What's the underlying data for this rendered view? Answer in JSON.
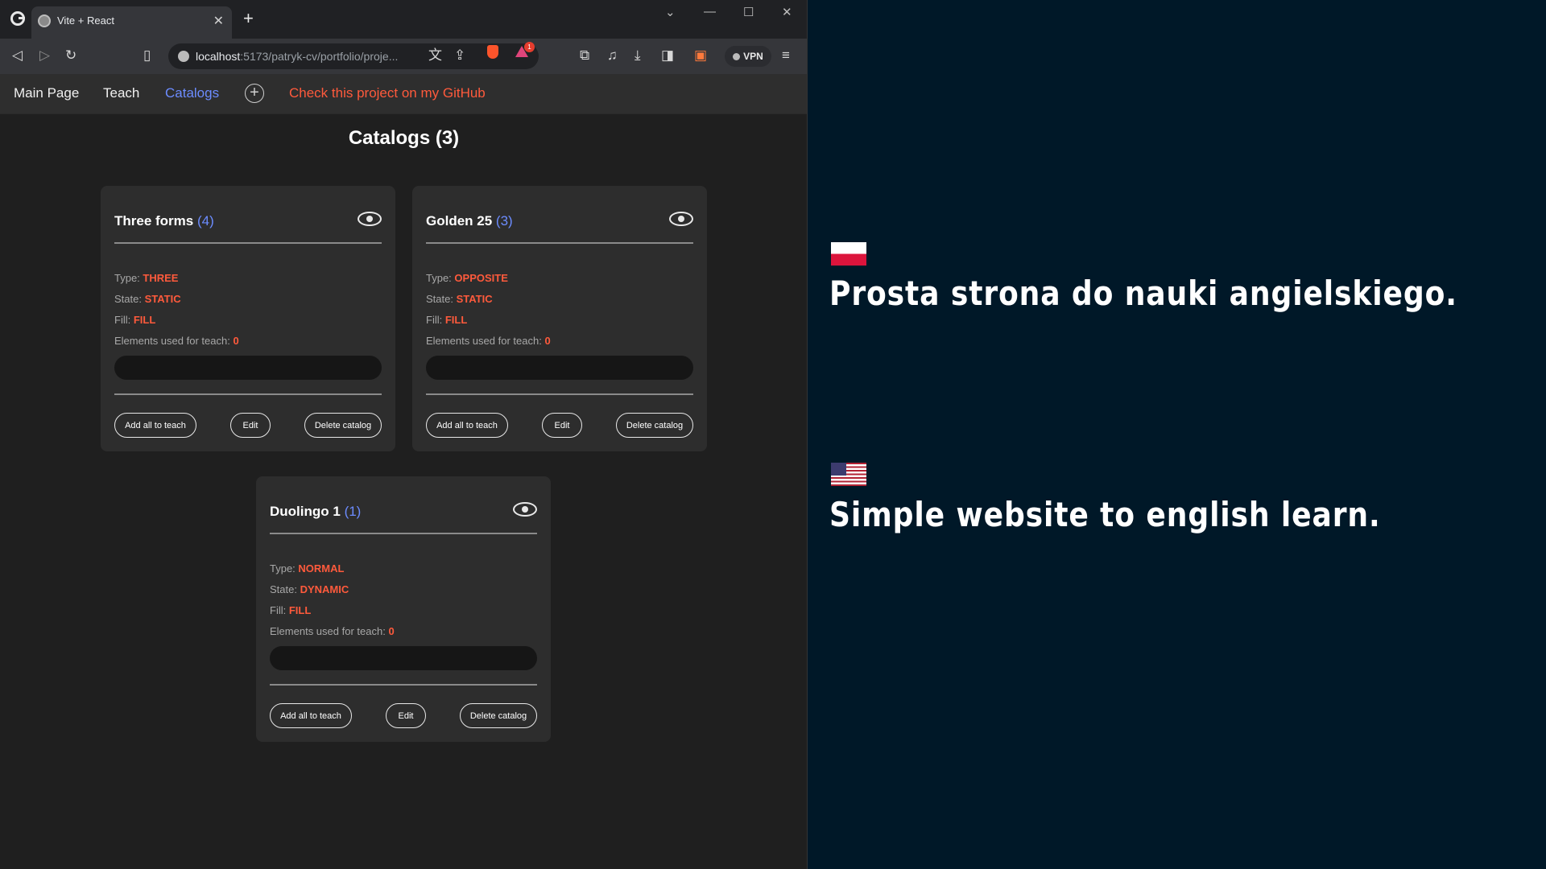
{
  "browser": {
    "tab_title": "Vite + React",
    "url_host": "localhost",
    "url_rest": ":5173/patryk-cv/portfolio/proje...",
    "vpn_label": "VPN",
    "rewards_badge": "1"
  },
  "nav": {
    "main_page": "Main Page",
    "teach": "Teach",
    "catalogs": "Catalogs",
    "github": "Check this project on my GitHub"
  },
  "page": {
    "title": "Catalogs (3)"
  },
  "labels": {
    "type": "Type:",
    "state": "State:",
    "fill": "Fill:",
    "elements": "Elements used for teach:",
    "add_all": "Add all to teach",
    "edit": "Edit",
    "delete": "Delete catalog"
  },
  "catalogs": [
    {
      "name": "Three forms",
      "count": "(4)",
      "type": "THREE",
      "state": "STATIC",
      "fill": "FILL",
      "elements": "0"
    },
    {
      "name": "Golden 25",
      "count": "(3)",
      "type": "OPPOSITE",
      "state": "STATIC",
      "fill": "FILL",
      "elements": "0"
    },
    {
      "name": "Duolingo 1",
      "count": "(1)",
      "type": "NORMAL",
      "state": "DYNAMIC",
      "fill": "FILL",
      "elements": "0"
    }
  ],
  "promo": {
    "polish": "Prosta strona do nauki angielskiego.",
    "english": "Simple website to english learn."
  },
  "colors": {
    "accent_blue": "#6c8cff",
    "accent_red": "#ff5a3c",
    "right_background": "#001828"
  }
}
